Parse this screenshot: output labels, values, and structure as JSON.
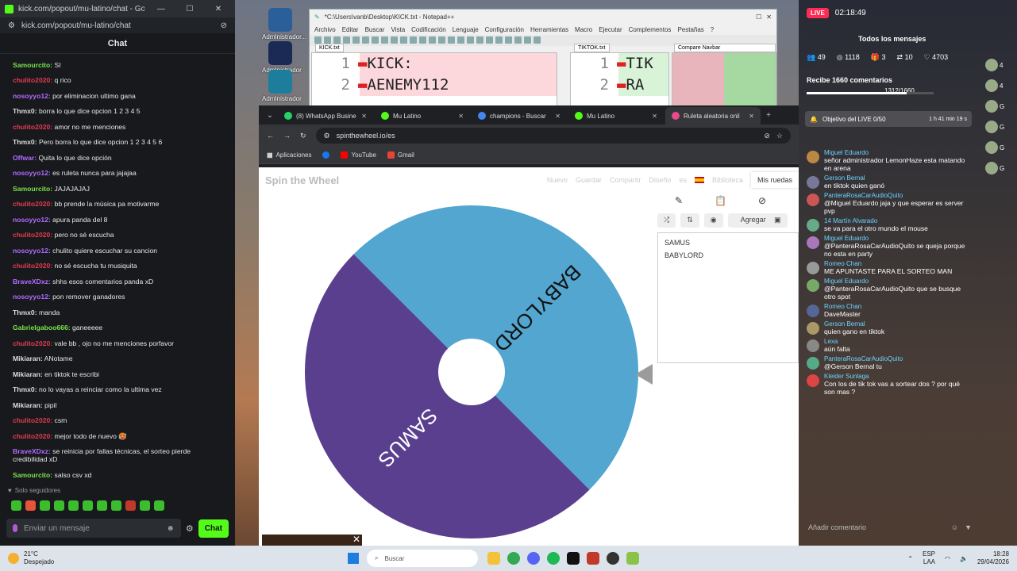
{
  "kick": {
    "title": "kick.com/popout/mu-latino/chat - Google Chrome",
    "url": "kick.com/popout/mu-latino/chat",
    "header": "Chat",
    "messages": [
      {
        "user": "Samourcito:",
        "text": " SI",
        "color": "#7ce34a"
      },
      {
        "user": "chulito2020:",
        "text": " q rico",
        "color": "#e33b50"
      },
      {
        "user": "nosoyyo12:",
        "text": " por eliminacion ultimo gana",
        "color": "#b36bff"
      },
      {
        "user": "Thmx0:",
        "text": " borra lo que dice opcion 1 2 3 4 5",
        "color": "#dddddd"
      },
      {
        "user": "chulito2020:",
        "text": " amor no me menciones",
        "color": "#e33b50"
      },
      {
        "user": "Thmx0:",
        "text": " Pero borra lo que dice opcion 1 2 3 4 5 6",
        "color": "#dddddd"
      },
      {
        "user": "Offwar:",
        "text": " Quita lo que dice opción",
        "color": "#b36bff"
      },
      {
        "user": "nosoyyo12:",
        "text": " es ruleta nunca para jajajaa",
        "color": "#b36bff"
      },
      {
        "user": "Samourcito:",
        "text": " JAJAJAJAJ",
        "color": "#7ce34a"
      },
      {
        "user": "chulito2020:",
        "text": " bb prende la música pa motivarme",
        "color": "#e33b50"
      },
      {
        "user": "nosoyyo12:",
        "text": " apura panda del 8",
        "color": "#b36bff"
      },
      {
        "user": "chulito2020:",
        "text": " pero no sé escucha",
        "color": "#e33b50"
      },
      {
        "user": "nosoyyo12:",
        "text": " chulito quiere escuchar su cancion",
        "color": "#b36bff"
      },
      {
        "user": "chulito2020:",
        "text": " no sé escucha tu musiquita",
        "color": "#e33b50"
      },
      {
        "user": "BraveXDxz:",
        "text": " shhs esos comentarios panda xD",
        "color": "#b36bff"
      },
      {
        "user": "nosoyyo12:",
        "text": " pon remover ganadores",
        "color": "#b36bff"
      },
      {
        "user": "Thmx0:",
        "text": " manda",
        "color": "#dddddd"
      },
      {
        "user": "Gabrielgaboo666:",
        "text": " ganeeeee",
        "color": "#7ce34a"
      },
      {
        "user": "chulito2020:",
        "text": " vale bb , ojo no me menciones porfavor",
        "color": "#e33b50"
      },
      {
        "user": "Mikiaran:",
        "text": " ANotame",
        "color": "#dddddd"
      },
      {
        "user": "Mikiaran:",
        "text": " en tiktok te escribi",
        "color": "#dddddd"
      },
      {
        "user": "Thmx0:",
        "text": " no lo vayas a reinciar como la ultima vez",
        "color": "#dddddd"
      },
      {
        "user": "Mikiaran:",
        "text": " pipil",
        "color": "#dddddd"
      },
      {
        "user": "chulito2020:",
        "text": " csm",
        "color": "#e33b50"
      },
      {
        "user": "chulito2020:",
        "text": " mejor todo de nuevo 🥵",
        "color": "#e33b50"
      },
      {
        "user": "BraveXDxz:",
        "text": " se reinicia por fallas técnicas, el sorteo pierde credibilidad xD",
        "color": "#b36bff"
      },
      {
        "user": "Samourcito:",
        "text": " salso csv xd",
        "color": "#7ce34a"
      }
    ],
    "followers_only": "Solo seguidores",
    "input_placeholder": "Enviar un mensaje",
    "chat_button": "Chat"
  },
  "desktop_icons": [
    {
      "label": "AdmInistrador...",
      "color": "#2b5f9a"
    },
    {
      "label": "AdmInistrador Tool",
      "color": "#1b2a55"
    },
    {
      "label": "AdmInistrador",
      "color": "#1c7e9c"
    }
  ],
  "notepad": {
    "title": "*C:\\Users\\vanb\\Desktop\\KICK.txt - Notepad++",
    "menu": [
      "Archivo",
      "Editar",
      "Buscar",
      "Vista",
      "Codificación",
      "Lenguaje",
      "Configuración",
      "Herramientas",
      "Macro",
      "Ejecutar",
      "Complementos",
      "Pestañas",
      "?"
    ],
    "tab1": "KICK.txt",
    "tab2": "TIKTOK.txt",
    "compare": "Compare Navbar",
    "lines_left": [
      {
        "n": "1",
        "t": "KICK:"
      },
      {
        "n": "2",
        "t": "AENEMY112"
      }
    ],
    "lines_right": [
      {
        "n": "1",
        "t": "TIK"
      },
      {
        "n": "2",
        "t": "RA"
      }
    ]
  },
  "chrome": {
    "tabs": [
      {
        "label": "(8) WhatsApp Busine",
        "color": "#25d366"
      },
      {
        "label": "Mu Latino",
        "color": "#53fc18"
      },
      {
        "label": "champions - Buscar",
        "color": "#4285f4"
      },
      {
        "label": "Mu Latino",
        "color": "#53fc18"
      },
      {
        "label": "Ruleta aleatoria onli",
        "color": "#e94b8a"
      }
    ],
    "url": "spinthewheel.io/es",
    "bookmarks": [
      "Aplicaciones",
      "YouTube",
      "Gmail"
    ]
  },
  "stw": {
    "logo": "Spin the Wheel",
    "nav": [
      "Nuevo",
      "Guardar",
      "Compartir",
      "Diseño",
      "es",
      "Biblioteca"
    ],
    "my_wheels": "Mis ruedas",
    "add_label": "Agregar",
    "entries": [
      "SAMUS",
      "BABYLORD"
    ],
    "segments": [
      {
        "label": "BABYLORD",
        "color": "#52a6cf"
      },
      {
        "label": "SAMUS",
        "color": "#5a3f8f"
      }
    ]
  },
  "tiktok": {
    "live": "LIVE",
    "timer": "02:18:49",
    "all_messages": "Todos los mensajes",
    "stats": [
      "49",
      "1118",
      "3",
      "10",
      "4703"
    ],
    "recibe": "Recibe 1660 comentarios",
    "progress": "1312/1660",
    "progress_fraction": 0.79,
    "goal": "Objetivo del LIVE 0/50",
    "goal_time": "1 h 41 min 19 s",
    "comments": [
      {
        "user": "Miguel Eduardo",
        "text": "señor administrador LemonHaze esta matando en arena"
      },
      {
        "user": "Gerson Bernal",
        "text": "en tiktok quien ganó"
      },
      {
        "user": "PanteraRosaCarAudioQuito",
        "text": "@Miguel Eduardo jaja y que esperar es server pvp"
      },
      {
        "user": "14  Martín Alvarado",
        "text": "se va para el otro mundo el mouse"
      },
      {
        "user": "Miguel Eduardo",
        "text": "@PanteraRosaCarAudioQuito se queja porque no esta en party"
      },
      {
        "user": "Romeo Chan",
        "text": "ME APUNTASTE PARA EL SORTEO MAN"
      },
      {
        "user": "Miguel Eduardo",
        "text": "@PanteraRosaCarAudioQuito que se busque otro spot"
      },
      {
        "user": "Romeo Chan",
        "text": "DaveMaster"
      },
      {
        "user": "Gerson Bernal",
        "text": "quien gano en tiktok"
      },
      {
        "user": "Lexa",
        "text": "aún falta"
      },
      {
        "user": "PanteraRosaCarAudioQuito",
        "text": "@Gerson Bernal tu"
      },
      {
        "user": "Kleider Sunlaga",
        "text": "Con los de tik tok vas a sortear dos ? por qué son mas ?"
      }
    ],
    "side_labels": [
      "4",
      "4",
      "G",
      "G",
      "G",
      "G"
    ],
    "add_comment": "Añadir comentario"
  },
  "taskbar": {
    "temp": "21°C",
    "weather": "Despejado",
    "search": "Buscar",
    "lang": "ESP",
    "lang2": "LAA",
    "time": "18:28",
    "date": "29/04/2026"
  }
}
